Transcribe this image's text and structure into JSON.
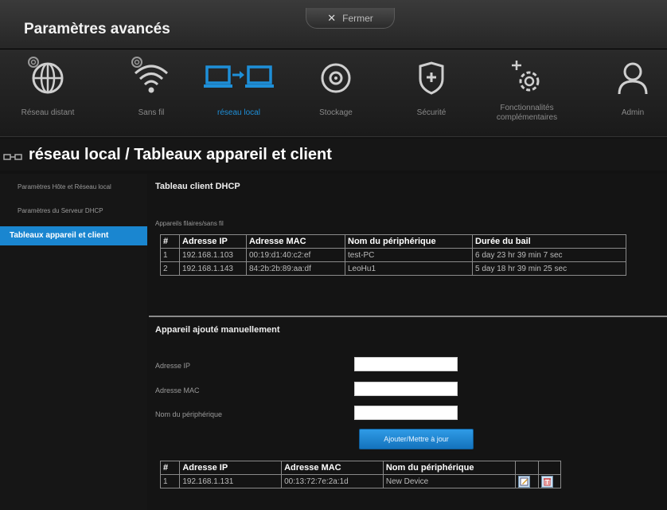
{
  "window": {
    "title": "Paramètres avancés",
    "close_label": "Fermer"
  },
  "nav": {
    "items": [
      {
        "label": "Réseau distant",
        "icon": "globe-icon"
      },
      {
        "label": "Sans fil",
        "icon": "wifi-icon"
      },
      {
        "label": "réseau local",
        "icon": "local-network-icon"
      },
      {
        "label": "Stockage",
        "icon": "storage-icon"
      },
      {
        "label": "Sécurité",
        "icon": "shield-icon"
      },
      {
        "label": "Fonctionnalités complémentaires",
        "icon": "gear-plus-icon"
      },
      {
        "label": "Admin",
        "icon": "user-icon"
      }
    ],
    "active_index": 2
  },
  "page": {
    "title": "réseau local / Tableaux appareil et client"
  },
  "sidebar": {
    "items": [
      {
        "label": "Paramètres Hôte et Réseau local"
      },
      {
        "label": "Paramètres du Serveur DHCP"
      },
      {
        "label": "Tableaux appareil et client"
      }
    ],
    "active_index": 2
  },
  "dhcp": {
    "title": "Tableau client DHCP",
    "subtitle": "Appareils filaires/sans fil",
    "columns": [
      "#",
      "Adresse IP",
      "Adresse MAC",
      "Nom du périphérique",
      "Durée du bail"
    ],
    "rows": [
      [
        "1",
        "192.168.1.103",
        "00:19:d1:40:c2:ef",
        "test-PC",
        "6 day 23 hr 39 min 7 sec"
      ],
      [
        "2",
        "192.168.1.143",
        "84:2b:2b:89:aa:df",
        "LeoHu1",
        "5 day 18 hr 39 min 25 sec"
      ]
    ]
  },
  "manual": {
    "title": "Appareil ajouté manuellement",
    "fields": {
      "ip_label": "Adresse IP",
      "mac_label": "Adresse MAC",
      "name_label": "Nom du périphérique",
      "ip_value": "",
      "mac_value": "",
      "name_value": ""
    },
    "button_label": "Ajouter/Mettre à jour",
    "columns": [
      "#",
      "Adresse IP",
      "Adresse MAC",
      "Nom du périphérique"
    ],
    "rows": [
      [
        "1",
        "192.168.1.131",
        "00:13:72:7e:2a:1d",
        "New Device"
      ]
    ],
    "row_actions": [
      "edit-icon",
      "delete-icon"
    ]
  },
  "colors": {
    "accent": "#1a86d0",
    "background": "#121212",
    "nav_inactive": "#8a8a8a"
  }
}
